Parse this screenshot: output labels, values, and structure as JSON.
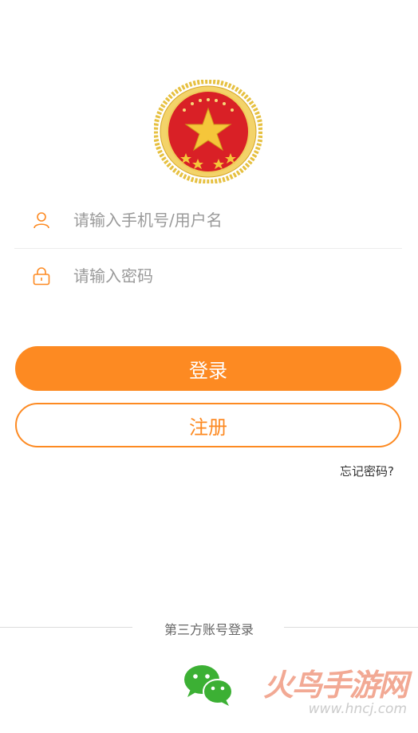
{
  "login_form": {
    "username_placeholder": "请输入手机号/用户名",
    "password_placeholder": "请输入密码",
    "login_label": "登录",
    "register_label": "注册",
    "forgot_label": "忘记密码?"
  },
  "third_party": {
    "label": "第三方账号登录",
    "providers": [
      {
        "icon": "wechat-icon"
      }
    ]
  },
  "watermark": {
    "title": "火鸟手游网",
    "url": "www.hncj.com"
  },
  "colors": {
    "accent": "#fd8a22",
    "divider": "#ececec",
    "placeholder": "#9a9a9a",
    "wechat": "#3cb034"
  }
}
